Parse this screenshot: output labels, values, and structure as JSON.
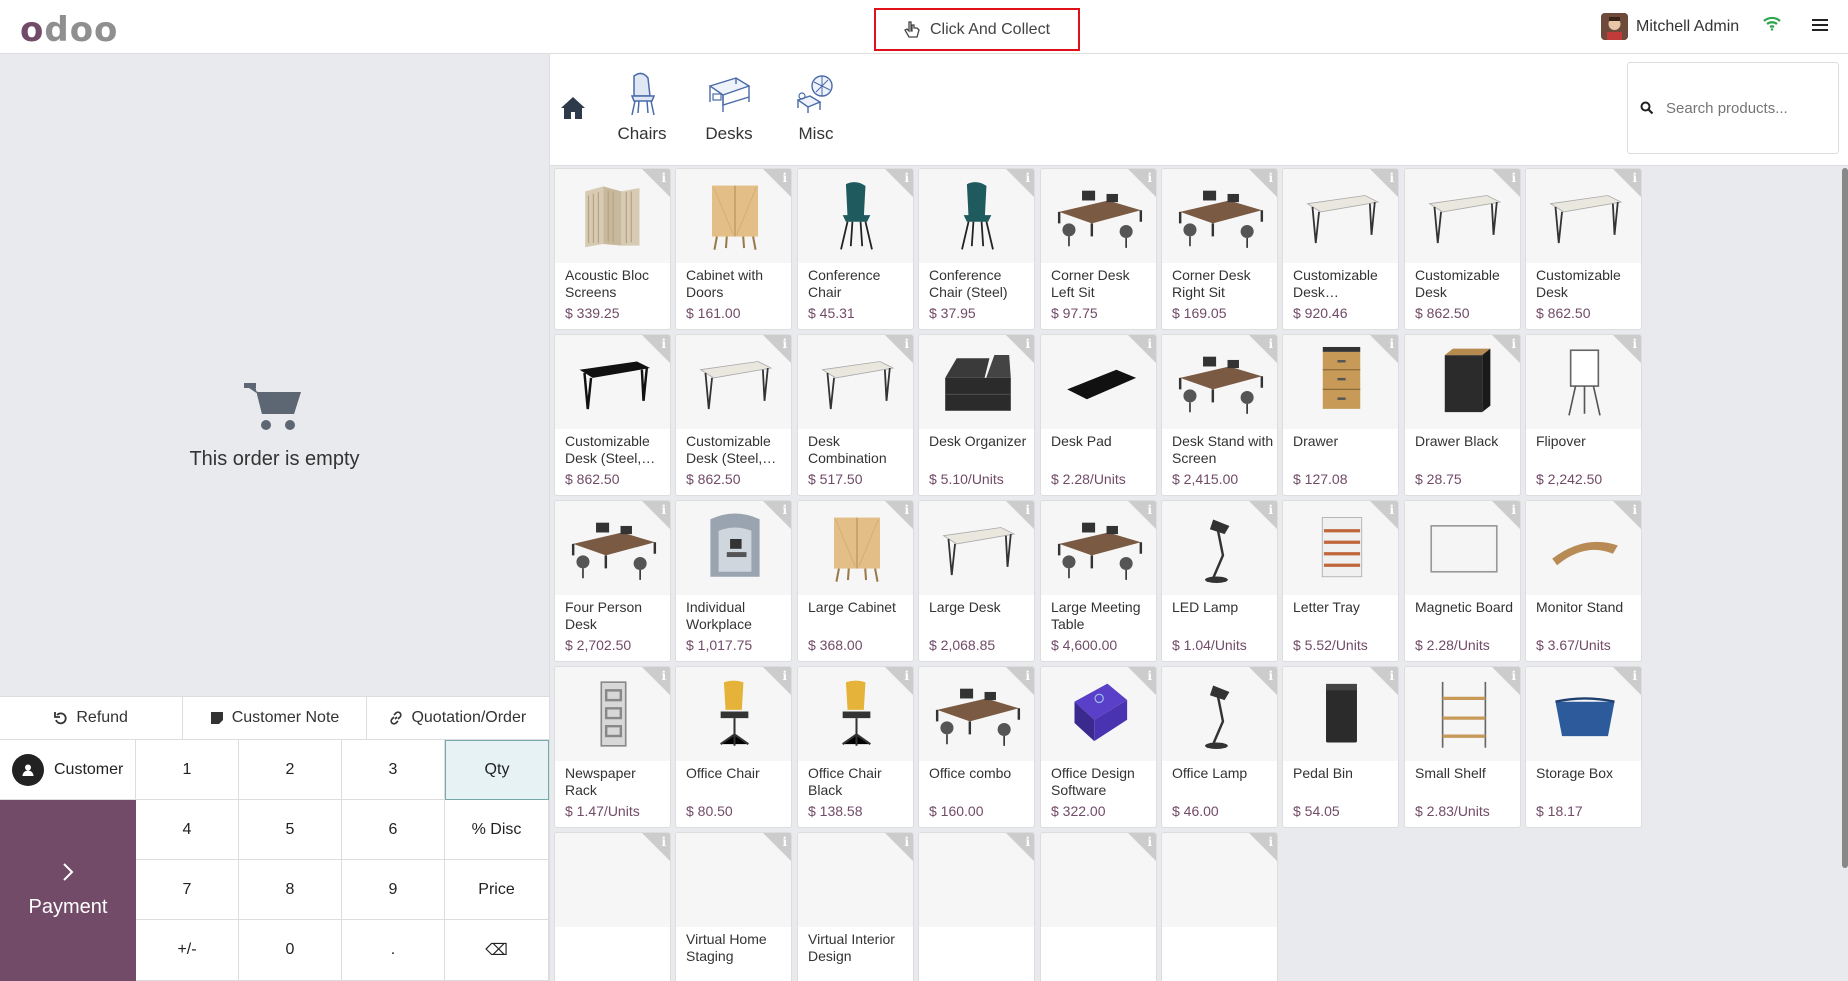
{
  "header": {
    "logo_o": "o",
    "logo_rest": "doo",
    "click_and_collect": "Click And Collect",
    "user_name": "Mitchell Admin"
  },
  "order": {
    "empty_text": "This order is empty"
  },
  "controls": {
    "refund": "Refund",
    "customer_note": "Customer Note",
    "quotation_order": "Quotation/Order"
  },
  "pad": {
    "customer": "Customer",
    "payment": "Payment",
    "keys": [
      "1",
      "2",
      "3",
      "Qty",
      "4",
      "5",
      "6",
      "% Disc",
      "7",
      "8",
      "9",
      "Price",
      "+/-",
      "0",
      ".",
      "⌫"
    ]
  },
  "categories": [
    "Chairs",
    "Desks",
    "Misc"
  ],
  "search": {
    "placeholder": "Search products..."
  },
  "products": [
    {
      "name": "Acoustic Bloc Screens",
      "price": "$ 339.25",
      "icon": "screen"
    },
    {
      "name": "Cabinet with Doors",
      "price": "$ 161.00",
      "icon": "cabinet"
    },
    {
      "name": "Conference Chair (Aluminium)",
      "price": "$ 45.31",
      "icon": "chair"
    },
    {
      "name": "Conference Chair (Steel)",
      "price": "$ 37.95",
      "icon": "chair"
    },
    {
      "name": "Corner Desk Left Sit",
      "price": "$ 97.75",
      "icon": "desk-set"
    },
    {
      "name": "Corner Desk Right Sit",
      "price": "$ 169.05",
      "icon": "desk-set"
    },
    {
      "name": "Customizable Desk…",
      "price": "$ 920.46",
      "icon": "table"
    },
    {
      "name": "Customizable Desk (Custom,…",
      "price": "$ 862.50",
      "icon": "table"
    },
    {
      "name": "Customizable Desk (Custom,…",
      "price": "$ 862.50",
      "icon": "table"
    },
    {
      "name": "Customizable Desk (Steel,…",
      "price": "$ 862.50",
      "icon": "table-black"
    },
    {
      "name": "Customizable Desk (Steel,…",
      "price": "$ 862.50",
      "icon": "table"
    },
    {
      "name": "Desk Combination",
      "price": "$ 517.50",
      "icon": "table"
    },
    {
      "name": "Desk Organizer",
      "price": "$ 5.10/Units",
      "icon": "organizer"
    },
    {
      "name": "Desk Pad",
      "price": "$ 2.28/Units",
      "icon": "pad"
    },
    {
      "name": "Desk Stand with Screen",
      "price": "$ 2,415.00",
      "icon": "desk-set"
    },
    {
      "name": "Drawer",
      "price": "$ 127.08",
      "icon": "drawer"
    },
    {
      "name": "Drawer Black",
      "price": "$ 28.75",
      "icon": "drawer-black"
    },
    {
      "name": "Flipover",
      "price": "$ 2,242.50",
      "icon": "flipover"
    },
    {
      "name": "Four Person Desk",
      "price": "$ 2,702.50",
      "icon": "desk-set"
    },
    {
      "name": "Individual Workplace",
      "price": "$ 1,017.75",
      "icon": "booth"
    },
    {
      "name": "Large Cabinet",
      "price": "$ 368.00",
      "icon": "cabinet"
    },
    {
      "name": "Large Desk",
      "price": "$ 2,068.85",
      "icon": "table"
    },
    {
      "name": "Large Meeting Table",
      "price": "$ 4,600.00",
      "icon": "desk-set"
    },
    {
      "name": "LED Lamp",
      "price": "$ 1.04/Units",
      "icon": "lamp"
    },
    {
      "name": "Letter Tray",
      "price": "$ 5.52/Units",
      "icon": "tray"
    },
    {
      "name": "Magnetic Board",
      "price": "$ 2.28/Units",
      "icon": "board"
    },
    {
      "name": "Monitor Stand",
      "price": "$ 3.67/Units",
      "icon": "stand"
    },
    {
      "name": "Newspaper Rack",
      "price": "$ 1.47/Units",
      "icon": "rack"
    },
    {
      "name": "Office Chair",
      "price": "$ 80.50",
      "icon": "office-chair"
    },
    {
      "name": "Office Chair Black",
      "price": "$ 138.58",
      "icon": "office-chair"
    },
    {
      "name": "Office combo",
      "price": "$ 160.00",
      "icon": "desk-set"
    },
    {
      "name": "Office Design Software",
      "price": "$ 322.00",
      "icon": "software"
    },
    {
      "name": "Office Lamp",
      "price": "$ 46.00",
      "icon": "lamp"
    },
    {
      "name": "Pedal Bin",
      "price": "$ 54.05",
      "icon": "bin"
    },
    {
      "name": "Small Shelf",
      "price": "$ 2.83/Units",
      "icon": "shelf"
    },
    {
      "name": "Storage Box",
      "price": "$ 18.17",
      "icon": "box"
    },
    {
      "name": "",
      "price": "",
      "icon": "none"
    },
    {
      "name": "Virtual Home Staging",
      "price": "",
      "icon": "none"
    },
    {
      "name": "Virtual Interior Design",
      "price": "",
      "icon": "none"
    },
    {
      "name": "",
      "price": "",
      "icon": "none"
    },
    {
      "name": "",
      "price": "",
      "icon": "none"
    },
    {
      "name": "",
      "price": "",
      "icon": "none"
    }
  ]
}
